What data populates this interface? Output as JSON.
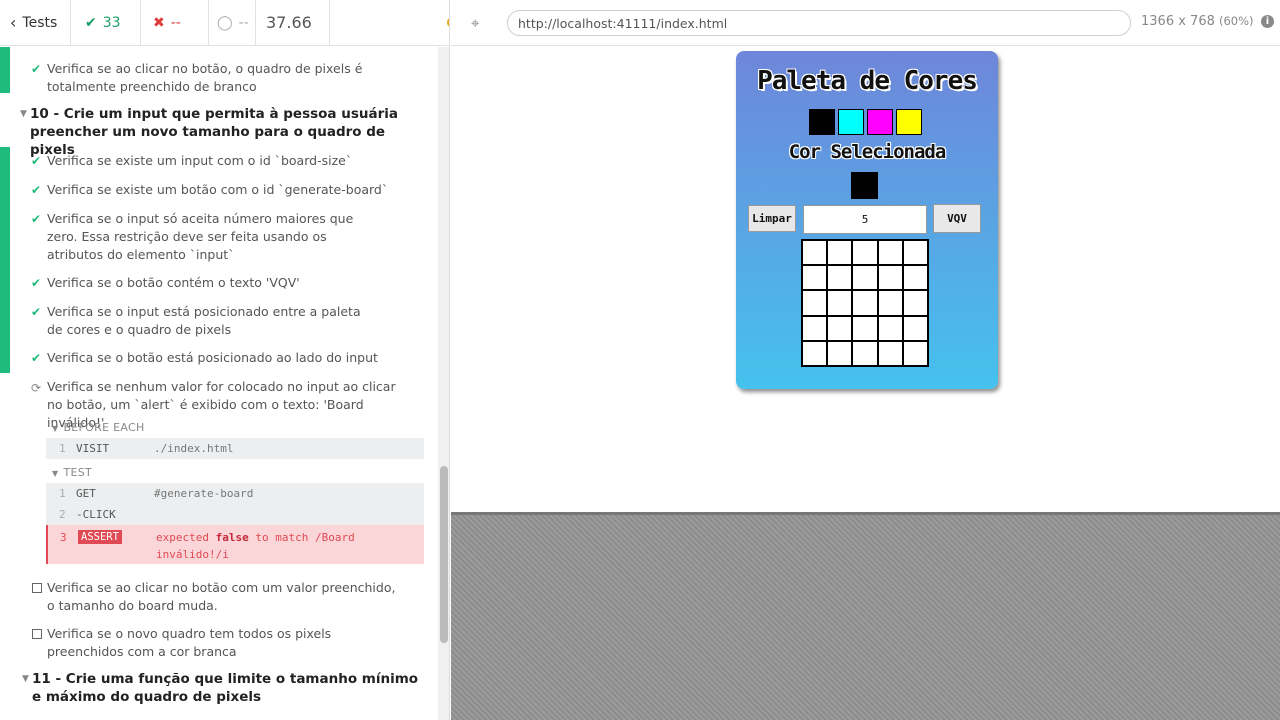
{
  "header": {
    "tests_label": "Tests",
    "passed": "33",
    "failed": "--",
    "pending": "--",
    "duration": "37.66"
  },
  "browser": {
    "url": "http://localhost:41111/index.html",
    "viewport": "1366 x 768",
    "scale": "(60%)"
  },
  "tests": {
    "t0": "Verifica se ao clicar no botão, o quadro de pixels é totalmente preenchido de branco",
    "suite10": "10 - Crie um input que permita à pessoa usuária preencher um novo tamanho para o quadro de pixels",
    "t1": "Verifica se existe um input com o id `board-size`",
    "t2": "Verifica se existe um botão com o id `generate-board`",
    "t3": "Verifica se o input só aceita número maiores que zero. Essa restrição deve ser feita usando os atributos do elemento `input`",
    "t4": "Verifica se o botão contém o texto 'VQV'",
    "t5": "Verifica se o input está posicionado entre a paleta de cores e o quadro de pixels",
    "t6": "Verifica se o botão está posicionado ao lado do input",
    "t7": "Verifica se nenhum valor for colocado no input ao clicar no botão, um `alert` é exibido com o texto: 'Board inválido!'",
    "before_each": "BEFORE EACH",
    "test_label": "TEST",
    "cmd1_num": "1",
    "cmd1_name": "VISIT",
    "cmd1_msg": "./index.html",
    "cmd2_num": "1",
    "cmd2_name": "GET",
    "cmd2_msg": "#generate-board",
    "cmd3_num": "2",
    "cmd3_name": "-CLICK",
    "cmd4_num": "3",
    "cmd4_badge": "ASSERT",
    "cmd4_msg_a": "expected ",
    "cmd4_msg_b": "false",
    "cmd4_msg_c": " to match /Board inválido!/i",
    "t8": "Verifica se ao clicar no botão com um valor preenchido, o tamanho do board muda.",
    "t9": "Verifica se o novo quadro tem todos os pixels preenchidos com a cor branca",
    "suite11": "11 - Crie uma função que limite o tamanho mínimo e máximo do quadro de pixels"
  },
  "app": {
    "title": "Paleta de Cores",
    "palette": [
      "#000000",
      "#00ffff",
      "#ff00ff",
      "#ffff00"
    ],
    "selected_title": "Cor Selecionada",
    "selected_color": "#000000",
    "clear_label": "Limpar",
    "board_size_value": "5",
    "vqv_label": "VQV",
    "board_size": 5
  }
}
